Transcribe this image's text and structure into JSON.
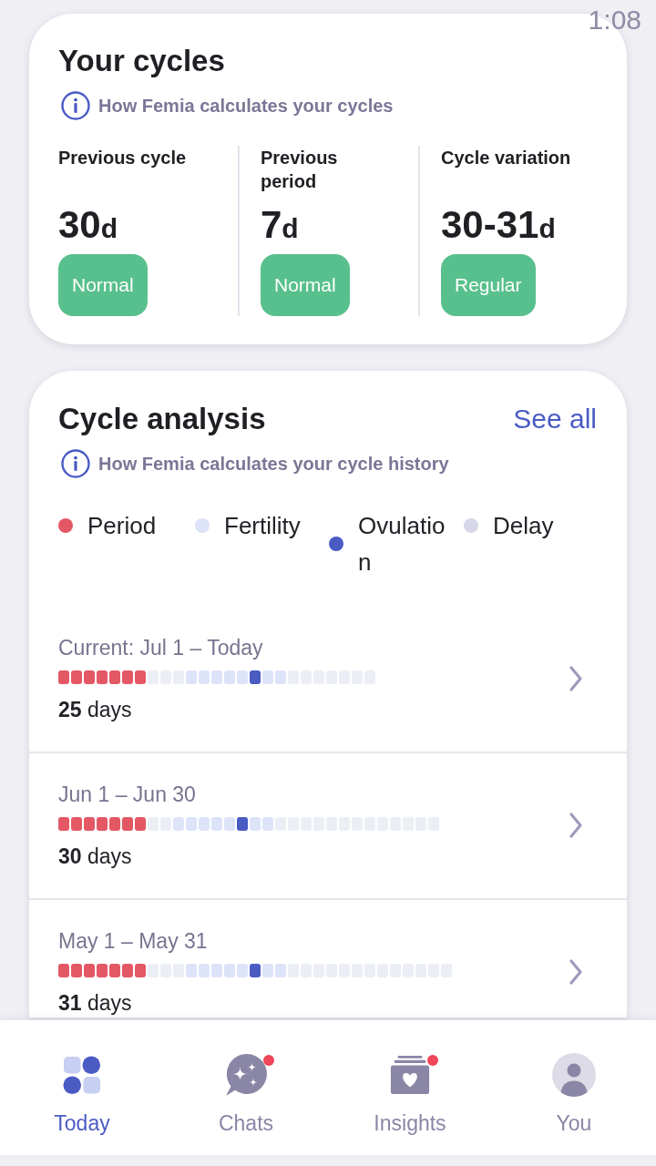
{
  "status_bar": {
    "time": "1:08"
  },
  "cycles_card": {
    "title": "Your cycles",
    "info_link": "How Femia calculates your cycles",
    "stats": [
      {
        "label": "Previous cycle",
        "value": "30d",
        "badge": "Normal"
      },
      {
        "label": "Previous period",
        "value": "7d",
        "badge": "Normal"
      },
      {
        "label": "Cycle variation",
        "value": "30-31d",
        "badge": "Regular"
      }
    ]
  },
  "analysis_card": {
    "title": "Cycle analysis",
    "see_all": "See all",
    "info_link": "How Femia calculates your cycle history",
    "legend": [
      {
        "label": "Period",
        "color": "#e45865"
      },
      {
        "label": "Fertility",
        "color": "#dde4fa"
      },
      {
        "label": "Ovulation",
        "color": "#4a5bc4"
      },
      {
        "label": "Delay",
        "color": "#d6d7e8"
      }
    ],
    "cycles": [
      {
        "dates": "Current: Jul 1 – Today",
        "length": "**25** days",
        "days": [
          {
            "kind": "period"
          },
          {
            "kind": "period"
          },
          {
            "kind": "period"
          },
          {
            "kind": "period"
          },
          {
            "kind": "period"
          },
          {
            "kind": "period"
          },
          {
            "kind": "period"
          },
          {
            "kind": "plain"
          },
          {
            "kind": "plain"
          },
          {
            "kind": "plain"
          },
          {
            "kind": "fertile"
          },
          {
            "kind": "fertile"
          },
          {
            "kind": "fertile"
          },
          {
            "kind": "fertile"
          },
          {
            "kind": "fertile"
          },
          {
            "kind": "ovulation"
          },
          {
            "kind": "fertile"
          },
          {
            "kind": "fertile"
          },
          {
            "kind": "plain"
          },
          {
            "kind": "plain"
          },
          {
            "kind": "plain"
          },
          {
            "kind": "plain"
          },
          {
            "kind": "plain"
          },
          {
            "kind": "plain"
          },
          {
            "kind": "plain"
          }
        ]
      },
      {
        "dates": "Jun 1 – Jun 30",
        "length": "**30** days",
        "days": [
          {
            "kind": "period"
          },
          {
            "kind": "period"
          },
          {
            "kind": "period"
          },
          {
            "kind": "period"
          },
          {
            "kind": "period"
          },
          {
            "kind": "period"
          },
          {
            "kind": "period"
          },
          {
            "kind": "plain"
          },
          {
            "kind": "plain"
          },
          {
            "kind": "fertile"
          },
          {
            "kind": "fertile"
          },
          {
            "kind": "fertile"
          },
          {
            "kind": "fertile"
          },
          {
            "kind": "fertile"
          },
          {
            "kind": "ovulation"
          },
          {
            "kind": "fertile"
          },
          {
            "kind": "fertile"
          },
          {
            "kind": "plain"
          },
          {
            "kind": "plain"
          },
          {
            "kind": "plain"
          },
          {
            "kind": "plain"
          },
          {
            "kind": "plain"
          },
          {
            "kind": "plain"
          },
          {
            "kind": "plain"
          },
          {
            "kind": "plain"
          },
          {
            "kind": "plain"
          },
          {
            "kind": "plain"
          },
          {
            "kind": "plain"
          },
          {
            "kind": "plain"
          },
          {
            "kind": "plain"
          }
        ]
      },
      {
        "dates": "May 1 – May 31",
        "length": "**31** days",
        "days": [
          {
            "kind": "period"
          },
          {
            "kind": "period"
          },
          {
            "kind": "period"
          },
          {
            "kind": "period"
          },
          {
            "kind": "period"
          },
          {
            "kind": "period"
          },
          {
            "kind": "period"
          },
          {
            "kind": "plain"
          },
          {
            "kind": "plain"
          },
          {
            "kind": "plain"
          },
          {
            "kind": "fertile"
          },
          {
            "kind": "fertile"
          },
          {
            "kind": "fertile"
          },
          {
            "kind": "fertile"
          },
          {
            "kind": "fertile"
          },
          {
            "kind": "ovulation"
          },
          {
            "kind": "fertile"
          },
          {
            "kind": "fertile"
          },
          {
            "kind": "plain"
          },
          {
            "kind": "plain"
          },
          {
            "kind": "plain"
          },
          {
            "kind": "plain"
          },
          {
            "kind": "plain"
          },
          {
            "kind": "plain"
          },
          {
            "kind": "plain"
          },
          {
            "kind": "plain"
          },
          {
            "kind": "plain"
          },
          {
            "kind": "plain"
          },
          {
            "kind": "plain"
          },
          {
            "kind": "plain"
          },
          {
            "kind": "plain"
          }
        ]
      }
    ]
  },
  "nav": [
    {
      "label": "Today",
      "selected": true,
      "badge": false
    },
    {
      "label": "Chats",
      "selected": false,
      "badge": true
    },
    {
      "label": "Insights",
      "selected": false,
      "badge": true
    },
    {
      "label": "You",
      "selected": false,
      "badge": false
    }
  ]
}
